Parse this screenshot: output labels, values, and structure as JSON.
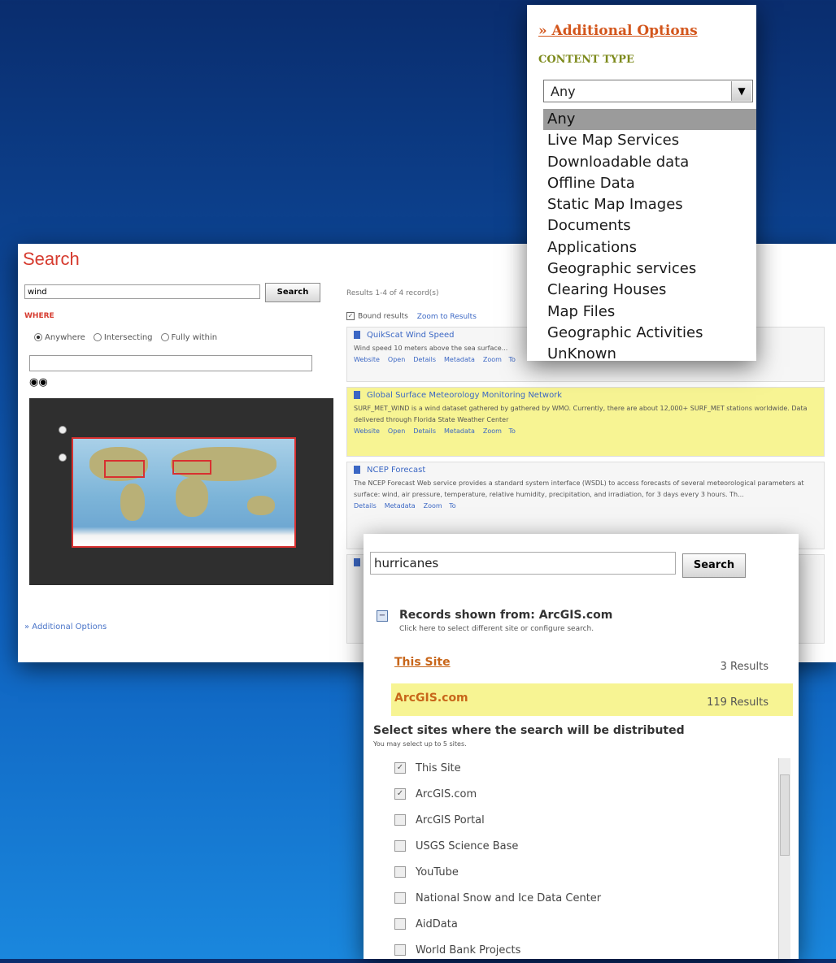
{
  "search": {
    "title": "Search",
    "keyword": "wind",
    "search_label": "Search",
    "where_label": "WHERE",
    "radio_options": [
      "Anywhere",
      "Intersecting",
      "Fully within"
    ],
    "additional_options_link": "» Additional Options",
    "results_summary": "Results 1-4 of 4 record(s)",
    "bound_label": "Bound results",
    "zoom_link": "Zoom to Results",
    "results": [
      {
        "title": "QuikScat Wind Speed",
        "description": "Wind speed 10 meters above the sea surface...",
        "links": [
          "Website",
          "Open",
          "Details",
          "Metadata",
          "Zoom To"
        ]
      },
      {
        "title": "Global Surface Meteorology Monitoring Network",
        "description": "SURF_MET_WIND is a wind dataset gathered by gathered by WMO. Currently, there are about 12,000+ SURF_MET stations worldwide. Data delivered through Florida State Weather Center",
        "links": [
          "Website",
          "Open",
          "Details",
          "Metadata",
          "Zoom To"
        ]
      },
      {
        "title": "NCEP Forecast",
        "description": "The NCEP Forecast Web service provides a standard system interface (WSDL) to access forecasts of several meteorological parameters at surface: wind, air pressure, temperature, relative humidity, precipitation, and irradiation, for 3 days every 3 hours. Th...",
        "links": [
          "Details",
          "Metadata",
          "Zoom To"
        ]
      }
    ]
  },
  "options": {
    "title": "» Additional Options",
    "content_type_label": "CONTENT TYPE",
    "selected": "Any",
    "items": [
      "Any",
      "Live Map Services",
      "Downloadable data",
      "Offline Data",
      "Static Map Images",
      "Documents",
      "Applications",
      "Geographic services",
      "Clearing Houses",
      "Map Files",
      "Geographic Activities",
      "UnKnown"
    ]
  },
  "distributed": {
    "query": "hurricanes",
    "search_label": "Search",
    "records_title": "Records shown from: ArcGIS.com",
    "records_sub": "Click here to select different site or configure search.",
    "sites": [
      {
        "name": "This Site",
        "count": "3 Results",
        "highlighted": false
      },
      {
        "name": "ArcGIS.com",
        "count": "119 Results",
        "highlighted": true
      }
    ],
    "select_heading": "Select sites where the search will be distributed",
    "select_sub": "You may select up to 5 sites.",
    "site_list": [
      {
        "label": "This Site",
        "checked": true
      },
      {
        "label": "ArcGIS.com",
        "checked": true
      },
      {
        "label": "ArcGIS Portal",
        "checked": false
      },
      {
        "label": "USGS Science Base",
        "checked": false
      },
      {
        "label": "YouTube",
        "checked": false
      },
      {
        "label": "National Snow and Ice Data Center",
        "checked": false
      },
      {
        "label": "AidData",
        "checked": false
      },
      {
        "label": "World Bank Projects",
        "checked": false
      }
    ]
  },
  "colors": {
    "accent_red": "#d63b2f",
    "orange_link": "#d3561c",
    "highlight_yellow": "#f7f493",
    "link_blue": "#3b67c4"
  }
}
